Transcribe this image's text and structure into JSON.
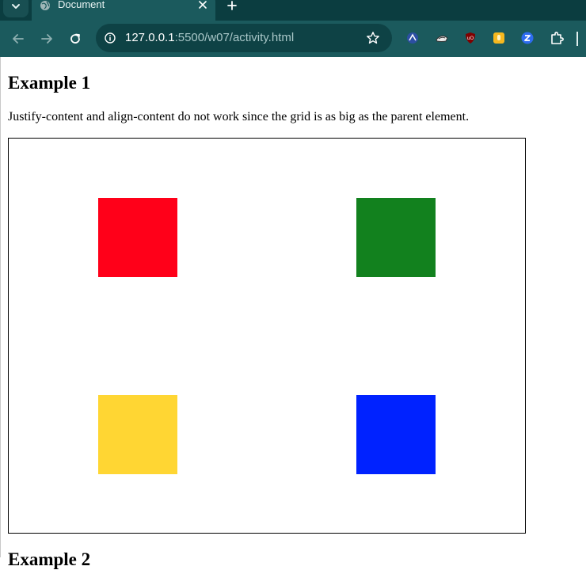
{
  "browser": {
    "tab_title": "Document",
    "url_host": "127.0.0.1",
    "url_rest": ":5500/w07/activity.html",
    "icons": {
      "tab_menu": "chevron-down-icon",
      "tab_favicon": "globe-icon",
      "tab_close": "close-icon",
      "new_tab": "plus-icon",
      "back": "arrow-left-icon",
      "forward": "arrow-right-icon",
      "reload": "reload-icon",
      "site_info": "info-icon",
      "bookmark": "star-icon",
      "extensions": [
        "extension-blue-icon",
        "extension-hat-icon",
        "ublock-icon",
        "extension-yellow-icon",
        "extension-z-icon",
        "puzzle-icon"
      ]
    },
    "colors": {
      "tabbar": "#0b3d40",
      "toolbar": "#1b5a5d",
      "omnibox": "#0e4245"
    }
  },
  "content": {
    "heading": "Example 1",
    "description": "Justify-content and align-content do not work since the grid is as big as the parent element.",
    "next_heading": "Example 2",
    "grid_items": [
      {
        "name": "red",
        "color": "#ff0019"
      },
      {
        "name": "green",
        "color": "#12811e"
      },
      {
        "name": "yellow",
        "color": "#ffd633"
      },
      {
        "name": "blue",
        "color": "#0022ff"
      }
    ]
  }
}
